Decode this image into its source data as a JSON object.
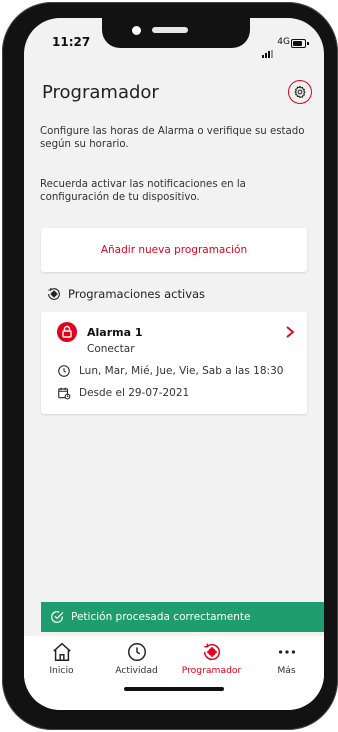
{
  "status_bar": {
    "time": "11:27",
    "network": "4G"
  },
  "header": {
    "title": "Programador"
  },
  "intro": {
    "text1": "Configure las horas de Alarma o verifique su estado según su horario.",
    "text2": "Recuerda activar las notificaciones en la configuración de tu dispositivo."
  },
  "add_button": {
    "label": "Añadir nueva programación"
  },
  "section": {
    "title": "Programaciones activas"
  },
  "schedule": {
    "name": "Alarma 1",
    "action": "Conectar",
    "days": "Lun, Mar, Mié, Jue, Vie, Sab  a las 18:30",
    "since": "Desde el 29-07-2021"
  },
  "toast": {
    "message": "Petición procesada correctamente"
  },
  "tabs": [
    {
      "label": "Inicio",
      "icon": "home-icon"
    },
    {
      "label": "Actividad",
      "icon": "clock-icon"
    },
    {
      "label": "Programador",
      "icon": "scheduler-icon",
      "active": true
    },
    {
      "label": "Más",
      "icon": "more-icon"
    }
  ],
  "colors": {
    "accent": "#e2001a",
    "success": "#1e9e6e",
    "background": "#f2f2f2"
  }
}
